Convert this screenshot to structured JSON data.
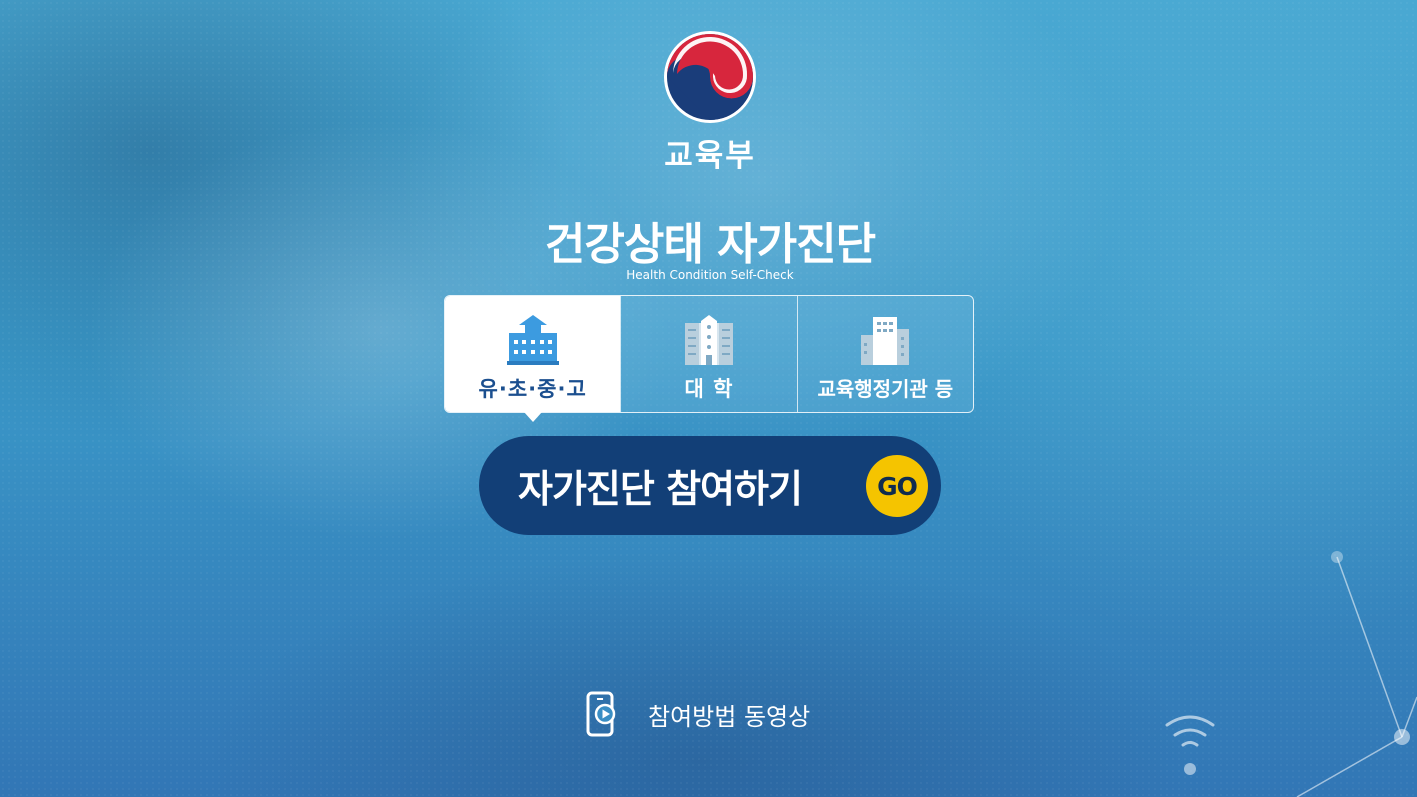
{
  "header": {
    "ministry_name": "교육부",
    "logo_icon": "taegeuk-logo-icon"
  },
  "hero": {
    "title": "건강상태 자가진단",
    "subtitle": "Health Condition Self-Check"
  },
  "tabs": [
    {
      "label": "유·초·중·고",
      "icon": "school-building-icon",
      "active": true
    },
    {
      "label": "대 학",
      "icon": "university-building-icon",
      "active": false
    },
    {
      "label": "교육행정기관 등",
      "icon": "office-building-icon",
      "active": false
    }
  ],
  "cta": {
    "label": "자가진단 참여하기",
    "badge": "GO",
    "badge_color": "#f5c400",
    "background_color": "#123f77"
  },
  "video": {
    "label": "참여방법 동영상",
    "icon": "phone-play-icon"
  }
}
